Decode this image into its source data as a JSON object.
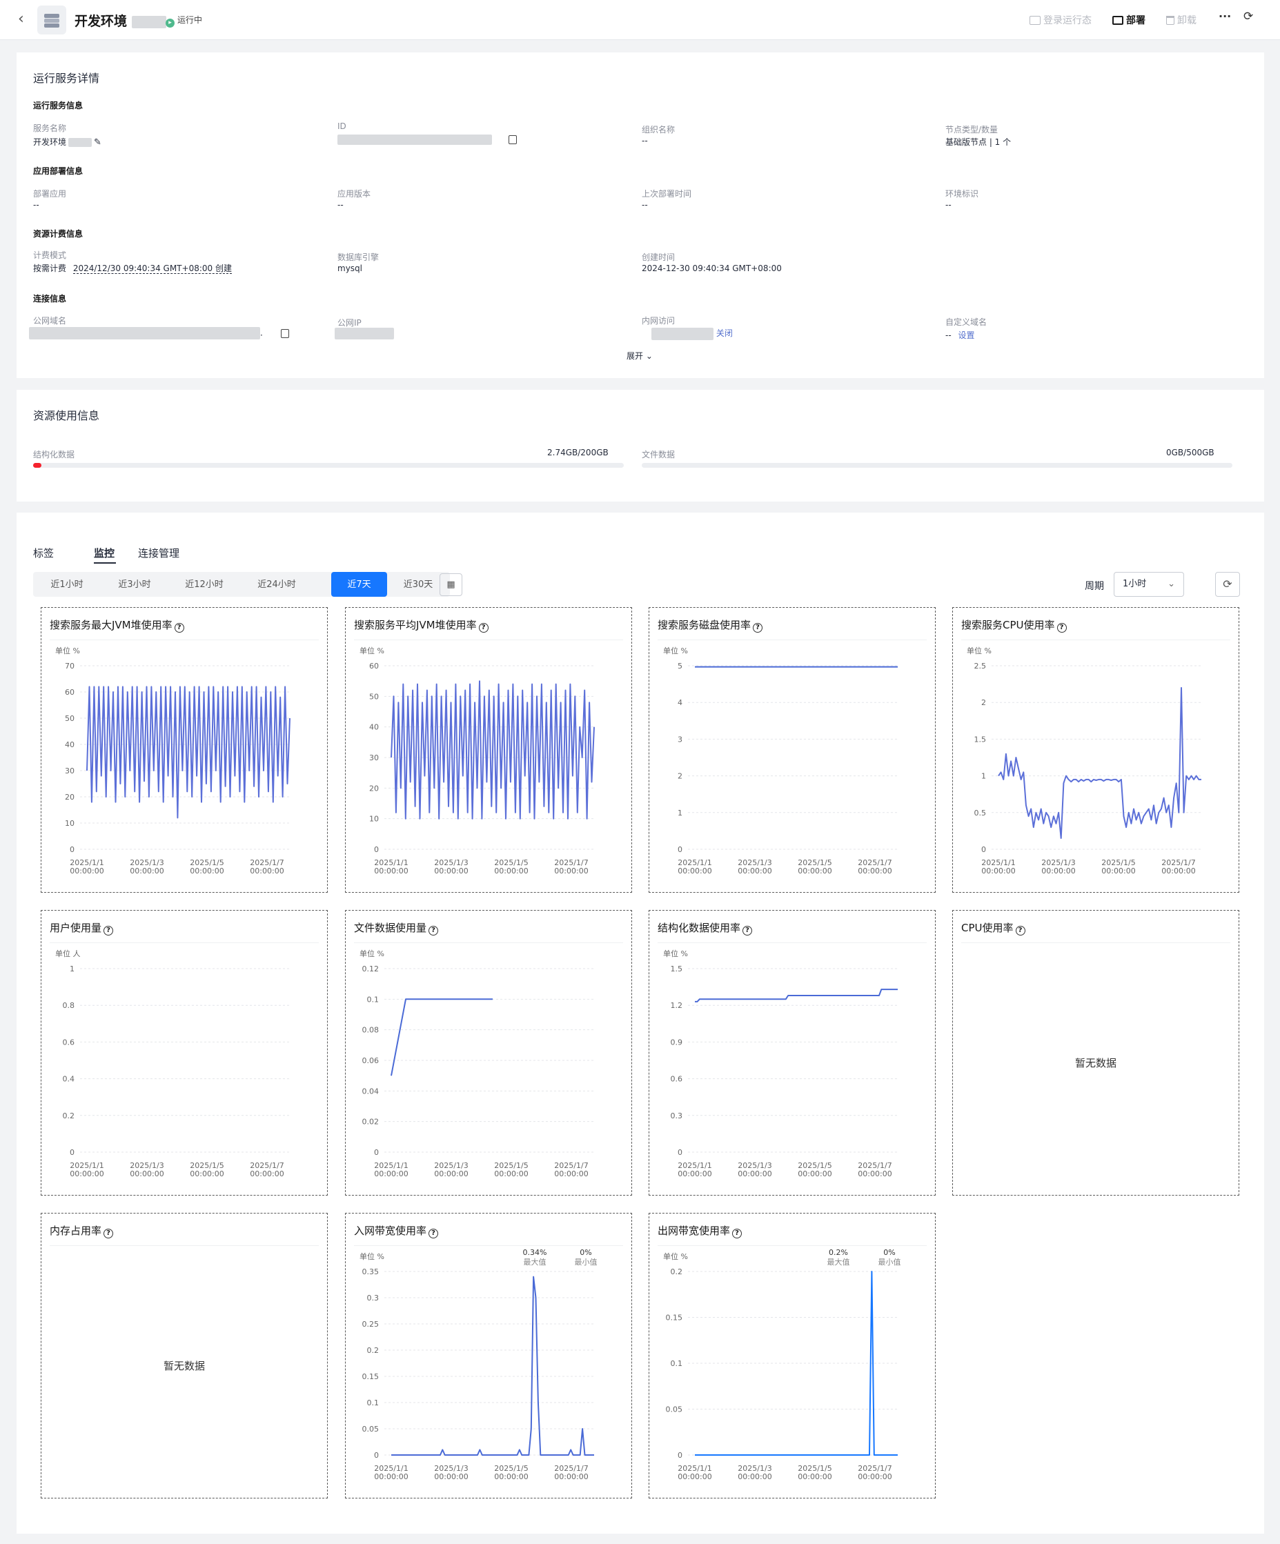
{
  "header": {
    "back_icon": "chevron-left-icon",
    "title": "开发环境",
    "status": "运行中",
    "actions": {
      "login_state": "登录运行态",
      "deploy": "部署",
      "uninstall": "卸载",
      "more": "···",
      "refresh": "⟳"
    }
  },
  "details": {
    "title": "运行服务详情",
    "sections": {
      "service": {
        "title": "运行服务信息",
        "fields": [
          {
            "label": "服务名称",
            "value": "开发环境"
          },
          {
            "label": "ID",
            "value": ""
          },
          {
            "label": "组织名称",
            "value": "--"
          },
          {
            "label": "节点类型/数量",
            "value": "基础版节点 | 1 个"
          }
        ]
      },
      "deploy": {
        "title": "应用部署信息",
        "fields": [
          {
            "label": "部署应用",
            "value": "--"
          },
          {
            "label": "应用版本",
            "value": "--"
          },
          {
            "label": "上次部署时间",
            "value": "--"
          },
          {
            "label": "环境标识",
            "value": "--"
          }
        ]
      },
      "billing": {
        "title": "资源计费信息",
        "fields": [
          {
            "label": "计费模式",
            "value": "按需计费",
            "extra": "2024/12/30 09:40:34 GMT+08:00 创建"
          },
          {
            "label": "数据库引擎",
            "value": "mysql"
          },
          {
            "label": "创建时间",
            "value": "2024-12-30 09:40:34 GMT+08:00"
          }
        ]
      },
      "connection": {
        "title": "连接信息",
        "fields": [
          {
            "label": "公网域名",
            "value": "."
          },
          {
            "label": "公网IP",
            "value": ""
          },
          {
            "label": "内网访问",
            "value": "",
            "link": "关闭"
          },
          {
            "label": "自定义域名",
            "value": "--",
            "link": "设置"
          }
        ]
      }
    },
    "expand": "展开"
  },
  "resources": {
    "title": "资源使用信息",
    "items": [
      {
        "label": "结构化数据",
        "value": "2.74GB/200GB",
        "fraction": 0.0137
      },
      {
        "label": "文件数据",
        "value": "0GB/500GB",
        "fraction": 0
      }
    ]
  },
  "tabs": [
    {
      "label": "标签"
    },
    {
      "label": "监控"
    },
    {
      "label": "连接管理"
    }
  ],
  "active_tab": "监控",
  "ranges": [
    "近1小时",
    "近3小时",
    "近12小时",
    "近24小时",
    "近7天",
    "近30天"
  ],
  "active_range": "近7天",
  "period": {
    "label": "周期",
    "value": "1小时"
  },
  "no_data": "暂无数据",
  "x_labels": [
    "2025/1/1",
    "2025/1/3",
    "2025/1/5",
    "2025/1/7"
  ],
  "x_time": "00:00:00",
  "chart_data": [
    {
      "id": "jvm_max",
      "type": "line",
      "title": "搜索服务最大JVM堆使用率",
      "unit": "单位 %",
      "ylim": [
        0,
        70
      ],
      "yticks": [
        "0",
        "10",
        "20",
        "30",
        "40",
        "50",
        "60",
        "70"
      ],
      "color": "#5b6fd8",
      "values": [
        30,
        62,
        18,
        62,
        22,
        62,
        28,
        62,
        20,
        62,
        30,
        60,
        18,
        62,
        25,
        62,
        20,
        60,
        30,
        62,
        22,
        62,
        18,
        60,
        26,
        62,
        20,
        62,
        30,
        60,
        22,
        62,
        18,
        62,
        28,
        62,
        20,
        60,
        12,
        62,
        30,
        62,
        22,
        60,
        20,
        62,
        28,
        62,
        18,
        60,
        25,
        62,
        22,
        62,
        30,
        60,
        18,
        62,
        24,
        62,
        20,
        60,
        28,
        62,
        22,
        62,
        18,
        60,
        30,
        62,
        24,
        62,
        20,
        58,
        30,
        62,
        22,
        60,
        18,
        62,
        28,
        58,
        20,
        62,
        25,
        50
      ]
    },
    {
      "id": "jvm_avg",
      "type": "line",
      "title": "搜索服务平均JVM堆使用率",
      "unit": "单位 %",
      "ylim": [
        0,
        60
      ],
      "yticks": [
        "0",
        "10",
        "20",
        "30",
        "40",
        "50",
        "60"
      ],
      "color": "#5b6fd8",
      "values": [
        30,
        50,
        12,
        48,
        20,
        54,
        10,
        50,
        22,
        52,
        14,
        54,
        10,
        48,
        24,
        52,
        12,
        50,
        20,
        54,
        10,
        50,
        22,
        52,
        14,
        48,
        12,
        54,
        10,
        50,
        24,
        52,
        12,
        54,
        10,
        48,
        20,
        55,
        10,
        50,
        22,
        52,
        14,
        50,
        12,
        54,
        20,
        48,
        10,
        52,
        22,
        54,
        12,
        50,
        10,
        52,
        24,
        48,
        12,
        54,
        10,
        50,
        22,
        54,
        14,
        48,
        12,
        52,
        10,
        54,
        20,
        48,
        12,
        52,
        10,
        54,
        24,
        50,
        12,
        40,
        30,
        52,
        10,
        48,
        22,
        40
      ]
    },
    {
      "id": "disk",
      "type": "line",
      "title": "搜索服务磁盘使用率",
      "unit": "单位 %",
      "ylim": [
        0,
        5
      ],
      "yticks": [
        "0",
        "1",
        "2",
        "3",
        "4",
        "5"
      ],
      "color": "#4a6ad6",
      "values": [
        4.97,
        4.97,
        4.97,
        4.97,
        4.97,
        4.97,
        4.97,
        4.97
      ]
    },
    {
      "id": "cpu_search",
      "type": "line",
      "title": "搜索服务CPU使用率",
      "unit": "单位 %",
      "ylim": [
        0,
        2.5
      ],
      "yticks": [
        "0",
        "0.5",
        "1",
        "1.5",
        "2",
        "2.5"
      ],
      "color": "#5b6fd8",
      "values": [
        1.0,
        1.05,
        0.95,
        1.3,
        1.0,
        1.2,
        1.0,
        1.25,
        1.1,
        0.95,
        1.05,
        0.6,
        0.45,
        0.55,
        0.3,
        0.5,
        0.4,
        0.55,
        0.35,
        0.5,
        0.45,
        0.3,
        0.45,
        0.35,
        0.5,
        0.15,
        0.9,
        1.0,
        0.95,
        0.92,
        0.95,
        0.95,
        0.92,
        0.95,
        0.93,
        0.95,
        0.95,
        0.92,
        0.95,
        0.94,
        0.95,
        0.95,
        0.93,
        0.95,
        0.95,
        0.94,
        0.95,
        0.95,
        0.92,
        0.95,
        0.45,
        0.3,
        0.5,
        0.35,
        0.55,
        0.4,
        0.5,
        0.35,
        0.45,
        0.5,
        0.55,
        0.4,
        0.6,
        0.35,
        0.5,
        0.55,
        0.7,
        0.5,
        0.6,
        0.3,
        0.7,
        0.9,
        0.5,
        2.2,
        0.5,
        1.0,
        0.95,
        1.0,
        0.95,
        1.0,
        0.95,
        0.95
      ]
    },
    {
      "id": "users",
      "type": "line",
      "title": "用户使用量",
      "unit": "单位 人",
      "ylim": [
        0,
        1
      ],
      "yticks": [
        "0",
        "0.2",
        "0.4",
        "0.6",
        "0.8",
        "1"
      ],
      "color": "#5b6fd8",
      "values": []
    },
    {
      "id": "file_data",
      "type": "line",
      "title": "文件数据使用量",
      "unit": "单位 %",
      "ylim": [
        0,
        0.12
      ],
      "yticks": [
        "0",
        "0.02",
        "0.04",
        "0.06",
        "0.08",
        "0.1",
        "0.12"
      ],
      "color": "#4a6ad6",
      "values": [
        0.05,
        0.1,
        0.1,
        0.1,
        0.1,
        0.1,
        0.1,
        0.1
      ],
      "span": 0.5
    },
    {
      "id": "struct",
      "type": "line",
      "title": "结构化数据使用率",
      "unit": "单位 %",
      "ylim": [
        0,
        1.5
      ],
      "yticks": [
        "0",
        "0.3",
        "0.6",
        "0.9",
        "1.2",
        "1.5"
      ],
      "color": "#4a6ad6",
      "values": [
        1.23,
        1.23,
        1.25,
        1.25,
        1.25,
        1.25,
        1.25,
        1.25,
        1.25,
        1.25,
        1.25,
        1.25,
        1.25,
        1.25,
        1.25,
        1.25,
        1.25,
        1.25,
        1.25,
        1.25,
        1.25,
        1.25,
        1.25,
        1.25,
        1.25,
        1.25,
        1.25,
        1.25,
        1.25,
        1.25,
        1.25,
        1.25,
        1.25,
        1.25,
        1.25,
        1.25,
        1.25,
        1.25,
        1.25,
        1.25,
        1.28,
        1.28,
        1.28,
        1.28,
        1.28,
        1.28,
        1.28,
        1.28,
        1.28,
        1.28,
        1.28,
        1.28,
        1.28,
        1.28,
        1.28,
        1.28,
        1.28,
        1.28,
        1.28,
        1.28,
        1.28,
        1.28,
        1.28,
        1.28,
        1.28,
        1.28,
        1.28,
        1.28,
        1.28,
        1.28,
        1.28,
        1.28,
        1.28,
        1.28,
        1.28,
        1.28,
        1.28,
        1.28,
        1.28,
        1.28,
        1.33,
        1.33,
        1.33,
        1.33,
        1.33,
        1.33,
        1.33,
        1.33
      ]
    },
    {
      "id": "cpu",
      "type": "line",
      "title": "CPU使用率",
      "values": null
    },
    {
      "id": "memory",
      "type": "line",
      "title": "内存占用率",
      "values": null
    },
    {
      "id": "net_in",
      "type": "line",
      "title": "入网带宽使用率",
      "unit": "单位 %",
      "ylim": [
        0,
        0.35
      ],
      "yticks": [
        "0",
        "0.05",
        "0.1",
        "0.15",
        "0.2",
        "0.25",
        "0.3",
        "0.35"
      ],
      "color": "#4a6ad6",
      "max": "0.34%",
      "max_label": "最大值",
      "min": "0%",
      "min_label": "最小值",
      "values": [
        0,
        0,
        0,
        0,
        0,
        0,
        0,
        0,
        0,
        0,
        0,
        0,
        0,
        0,
        0,
        0,
        0,
        0,
        0,
        0,
        0,
        0,
        0.01,
        0,
        0,
        0,
        0,
        0,
        0,
        0,
        0,
        0,
        0,
        0,
        0,
        0,
        0,
        0,
        0.01,
        0,
        0,
        0,
        0,
        0,
        0,
        0,
        0,
        0,
        0,
        0,
        0,
        0,
        0,
        0,
        0,
        0.01,
        0,
        0,
        0,
        0,
        0.05,
        0.34,
        0.3,
        0.1,
        0,
        0,
        0,
        0,
        0,
        0,
        0,
        0,
        0,
        0,
        0,
        0,
        0,
        0.01,
        0,
        0,
        0,
        0,
        0.05,
        0,
        0,
        0,
        0,
        0
      ]
    },
    {
      "id": "net_out",
      "type": "line",
      "title": "出网带宽使用率",
      "unit": "单位 %",
      "ylim": [
        0,
        0.2
      ],
      "yticks": [
        "0",
        "0.05",
        "0.1",
        "0.15",
        "0.2"
      ],
      "color": "#1677ff",
      "max": "0.2%",
      "max_label": "最大值",
      "min": "0%",
      "min_label": "最小值",
      "values": [
        0,
        0,
        0,
        0,
        0,
        0,
        0,
        0,
        0,
        0,
        0,
        0,
        0,
        0,
        0,
        0,
        0,
        0,
        0,
        0,
        0,
        0,
        0,
        0,
        0,
        0,
        0,
        0,
        0,
        0,
        0,
        0,
        0,
        0,
        0,
        0,
        0,
        0,
        0,
        0,
        0,
        0,
        0,
        0,
        0,
        0,
        0,
        0,
        0,
        0,
        0,
        0,
        0,
        0,
        0,
        0,
        0,
        0,
        0,
        0,
        0,
        0,
        0,
        0,
        0,
        0,
        0,
        0,
        0,
        0,
        0,
        0,
        0,
        0,
        0,
        0.2,
        0,
        0,
        0,
        0,
        0,
        0,
        0,
        0,
        0,
        0,
        0
      ]
    }
  ]
}
